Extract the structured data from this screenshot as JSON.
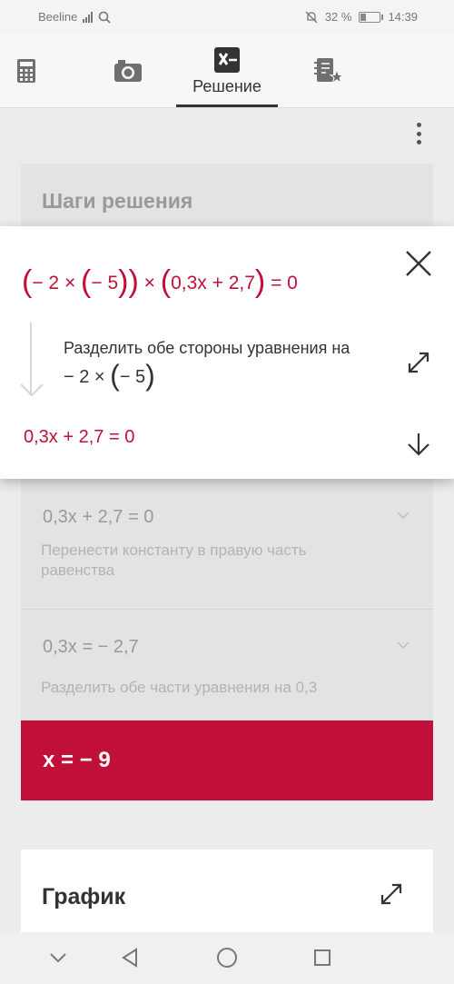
{
  "status_bar": {
    "carrier": "Beeline",
    "battery": "32 %",
    "time": "14:39"
  },
  "toolbar": {
    "tabs": [
      {
        "icon": "calculator-icon"
      },
      {
        "icon": "camera-icon"
      },
      {
        "icon": "solution-icon",
        "label": "Решение",
        "active": true
      },
      {
        "icon": "notebook-star-icon"
      }
    ]
  },
  "steps": {
    "title": "Шаги решения",
    "popup": {
      "equation_parts": {
        "open1": "(",
        "t1": "− 2 × ",
        "open2": "(",
        "t2": "− 5",
        "close2": ")",
        "close1": ")",
        "t3": " × ",
        "open3": "(",
        "t4": "0,3x + 2,7",
        "close3": ")",
        "t5": " = 0"
      },
      "description_line1": "Разделить обе стороны уравнения на",
      "description_line2": {
        "t1": "− 2 × ",
        "open": "(",
        "t2": "− 5",
        "close": ")"
      },
      "result": "0,3x + 2,7 = 0"
    },
    "items": [
      {
        "equation": "0,3x + 2,7 = 0",
        "description": "Перенести константу в правую часть равенства"
      },
      {
        "equation": "0,3x = − 2,7",
        "description": "Разделить обе части уравнения на 0,3"
      }
    ],
    "answer": "x = − 9"
  },
  "graph": {
    "title": "График"
  },
  "colors": {
    "accent": "#c0103a",
    "background": "#ececec"
  }
}
